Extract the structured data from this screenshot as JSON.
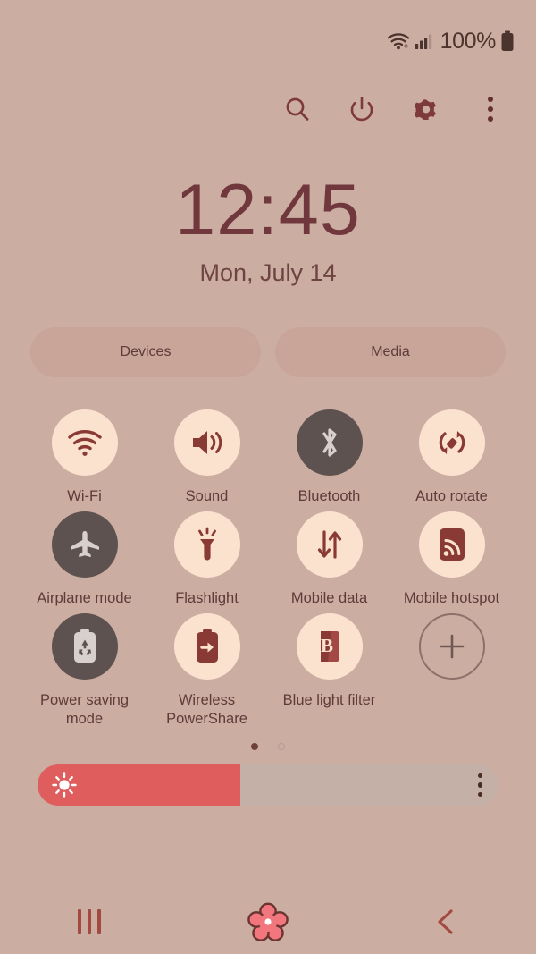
{
  "status_bar": {
    "wifi_icon": "wifi-icon",
    "signal_icon": "cellular-signal-icon",
    "battery_percent": "100%",
    "battery_icon": "battery-full-icon"
  },
  "header": {
    "buttons": [
      {
        "name": "search-icon",
        "label": "Search"
      },
      {
        "name": "power-icon",
        "label": "Power off"
      },
      {
        "name": "gear-icon",
        "label": "Settings"
      },
      {
        "name": "more-options-icon",
        "label": "More options"
      }
    ]
  },
  "clock": {
    "time": "12:45",
    "date": "Mon, July 14"
  },
  "pills": [
    {
      "label": "Devices"
    },
    {
      "label": "Media"
    }
  ],
  "tiles": [
    {
      "label": "Wi-Fi",
      "icon": "wifi-icon",
      "state": "on"
    },
    {
      "label": "Sound",
      "icon": "speaker-icon",
      "state": "on"
    },
    {
      "label": "Bluetooth",
      "icon": "bluetooth-icon",
      "state": "off"
    },
    {
      "label": "Auto rotate",
      "icon": "auto-rotate-icon",
      "state": "on"
    },
    {
      "label": "Airplane mode",
      "icon": "airplane-icon",
      "state": "off"
    },
    {
      "label": "Flashlight",
      "icon": "flashlight-icon",
      "state": "on"
    },
    {
      "label": "Mobile data",
      "icon": "mobile-data-icon",
      "state": "on"
    },
    {
      "label": "Mobile hotspot",
      "icon": "hotspot-icon",
      "state": "on"
    },
    {
      "label": "Power saving mode",
      "icon": "power-saving-icon",
      "state": "off"
    },
    {
      "label": "Wireless PowerShare",
      "icon": "powershare-icon",
      "state": "on"
    },
    {
      "label": "Blue light filter",
      "icon": "blue-light-icon",
      "state": "on"
    },
    {
      "label": "",
      "icon": "add-icon",
      "state": "add"
    }
  ],
  "page_indicator": {
    "total": 2,
    "active": 1
  },
  "brightness": {
    "value_percent": 44,
    "icon": "brightness-sun-icon",
    "menu_icon": "more-options-icon"
  },
  "navigation": {
    "recents": "recents-icon",
    "home": "home-flower-icon",
    "back": "back-icon"
  },
  "colors": {
    "background": "#ccada2",
    "tile_on": "#fbe2cf",
    "tile_off": "#5d524f",
    "accent_red": "#e05d5d",
    "icon_dark": "#8a3a35",
    "text": "#5e3b39",
    "home_pink": "#f2767d"
  }
}
